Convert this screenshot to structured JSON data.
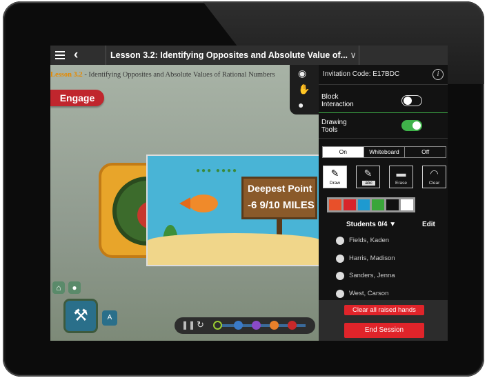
{
  "app": {
    "lesson_title": "Lesson 3.2: Identifying Opposites and Absolute Value of...",
    "chevron": "∨"
  },
  "content": {
    "subtitle_lesson": "Lesson 3.2",
    "subtitle_rest": " - Identifying Opposites and Absolute Values of Rational Numbers",
    "engage_label": "Engage",
    "sign_title": "Deepest Point",
    "sign_value": "-6 9/10 MILES"
  },
  "panel": {
    "invitation_code": "Invitation Code: E17BDC",
    "block_interaction_label": "Block\nInteraction",
    "block_interaction_on": false,
    "drawing_tools_label": "Drawing\nTools",
    "drawing_tools_on": true,
    "mode_segments": [
      {
        "label": "On",
        "selected": true
      },
      {
        "label": "Whiteboard",
        "selected": false
      },
      {
        "label": "Off",
        "selected": false
      }
    ],
    "tools": [
      {
        "label": "Draw",
        "icon": "pencil-icon",
        "active": true
      },
      {
        "label": "",
        "icon": "pencil-abc-icon",
        "badge": "abc",
        "active": false
      },
      {
        "label": "Erase",
        "icon": "eraser-icon",
        "active": false
      },
      {
        "label": "Clear",
        "icon": "clear-gauge-icon",
        "active": false
      }
    ],
    "colors": [
      "#e8502a",
      "#d8242a",
      "#1e9ad0",
      "#3aa63a",
      "#111111",
      "#ffffff"
    ],
    "students_header": "Students 0/4",
    "edit_label": "Edit",
    "students": [
      "Fields, Kaden",
      "Harris, Madison",
      "Sanders, Jenna",
      "West, Carson"
    ],
    "clear_raised_label": "Clear all raised hands",
    "end_session_label": "End Session"
  },
  "accent": {
    "toggle_on": "#3fb34a",
    "danger": "#e0242a",
    "engage": "#c0262d"
  }
}
